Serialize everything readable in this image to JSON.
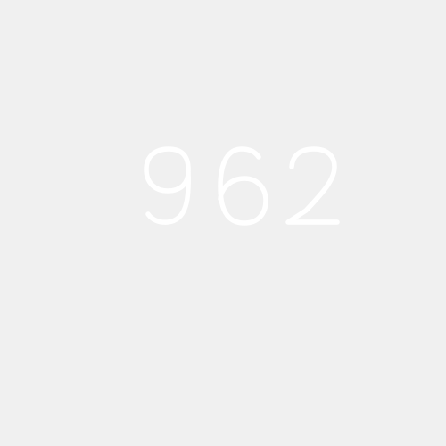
{
  "captcha": {
    "text": "962",
    "characters": [
      "9",
      "6",
      "2"
    ]
  },
  "colors": {
    "background": "#f0f0f0",
    "text_fill": "#ffffff",
    "text_edge": "#e4e4e4"
  }
}
